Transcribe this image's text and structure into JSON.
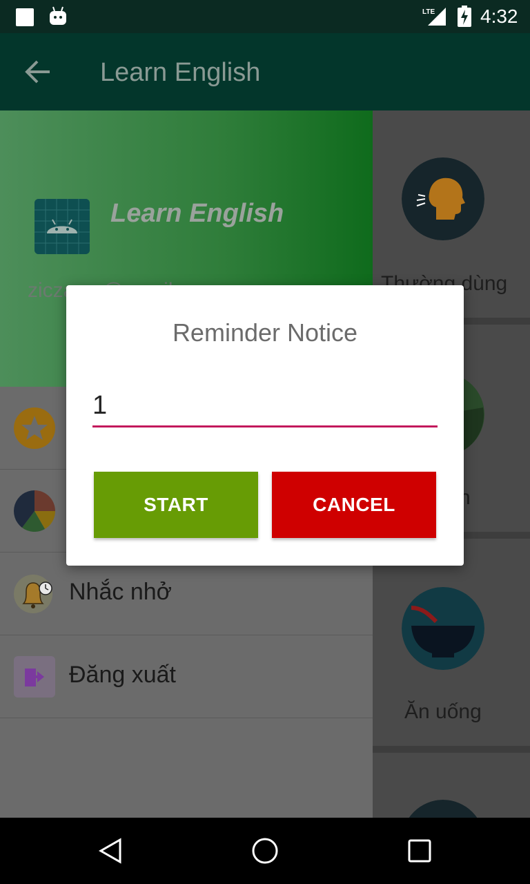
{
  "status_bar": {
    "time": "4:32",
    "network": "LTE"
  },
  "app_bar": {
    "title": "Learn English",
    "back_icon": "arrow-back-icon"
  },
  "drawer": {
    "title": "Learn English",
    "email": "ziczac...@gmail...",
    "items": [
      {
        "label": "",
        "icon": "star-icon"
      },
      {
        "label": "",
        "icon": "pie-chart-icon"
      },
      {
        "label": "Nhắc nhở",
        "icon": "bell-clock-icon"
      },
      {
        "label": "Đăng xuất",
        "icon": "logout-icon"
      }
    ]
  },
  "content": {
    "cards": [
      {
        "label": "Thường dùng",
        "icon": "speaking-head-icon"
      },
      {
        "label": "...h",
        "icon": "circle-green-icon"
      },
      {
        "label": "Ăn uống",
        "icon": "bowl-icon"
      }
    ]
  },
  "dialog": {
    "title": "Reminder Notice",
    "input_value": "1",
    "start_label": "START",
    "cancel_label": "CANCEL",
    "colors": {
      "start": "#679c05",
      "cancel": "#cf0000",
      "underline": "#c2185b"
    }
  }
}
